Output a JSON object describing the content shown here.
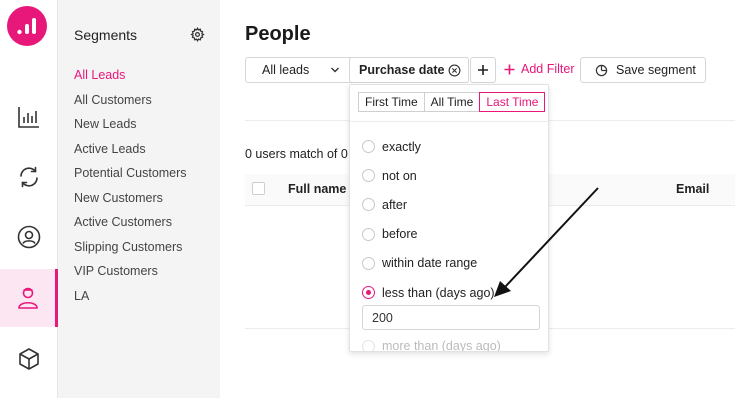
{
  "sidebar_nav": {
    "items": [
      {
        "icon": "bar-chart-icon"
      },
      {
        "icon": "sync-icon"
      },
      {
        "icon": "user-circle-icon"
      },
      {
        "icon": "people-icon",
        "active": true
      },
      {
        "icon": "box-icon"
      }
    ],
    "accent": "#e8177a"
  },
  "segments": {
    "title": "Segments",
    "items": [
      {
        "label": "All Leads",
        "active": true
      },
      {
        "label": "All Customers"
      },
      {
        "label": "New Leads"
      },
      {
        "label": "Active Leads"
      },
      {
        "label": "Potential Customers"
      },
      {
        "label": "New Customers"
      },
      {
        "label": "Active Customers"
      },
      {
        "label": "Slipping Customers"
      },
      {
        "label": "VIP Customers"
      },
      {
        "label": "LA"
      }
    ]
  },
  "main": {
    "title": "People",
    "segment_select": "All leads",
    "active_filter": "Purchase date",
    "add_filter_label": "Add Filter",
    "save_segment_label": "Save segment",
    "match_text": "0 users match of 0",
    "table_headers": {
      "name": "Full name",
      "email": "Email"
    }
  },
  "filter_dropdown": {
    "tabs": [
      {
        "label": "First Time"
      },
      {
        "label": "All Time"
      },
      {
        "label": "Last Time",
        "active": true
      }
    ],
    "options": [
      {
        "label": "exactly",
        "selected": false
      },
      {
        "label": "not on",
        "selected": false
      },
      {
        "label": "after",
        "selected": false
      },
      {
        "label": "before",
        "selected": false
      },
      {
        "label": "within date range",
        "selected": false
      },
      {
        "label": "less than (days ago)",
        "selected": true
      }
    ],
    "days_value": "200",
    "next_option_label": "more than (days ago)"
  }
}
